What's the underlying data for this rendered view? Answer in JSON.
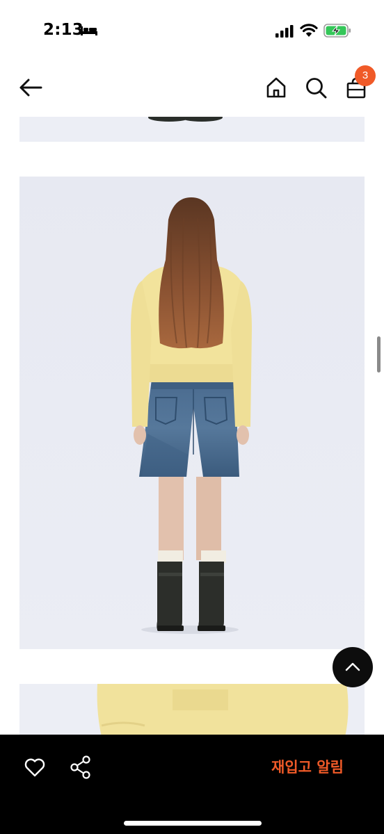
{
  "status_bar": {
    "time": "2:13",
    "icons": [
      "bed-icon",
      "signal-icon",
      "wifi-icon",
      "battery-charging-icon"
    ],
    "battery_color": "#34c759"
  },
  "nav_bar": {
    "icons": [
      "back-arrow-icon",
      "home-icon",
      "search-icon",
      "shopping-bag-icon"
    ],
    "cart_count": "3",
    "badge_color": "#f05a28"
  },
  "product_images": [
    {
      "name": "product-image-boots-partial"
    },
    {
      "name": "product-image-back-view"
    },
    {
      "name": "product-image-sweater-closeup"
    }
  ],
  "scroll_top": {
    "icon": "chevron-up-icon"
  },
  "bottom_bar": {
    "icons": [
      "heart-icon",
      "share-icon"
    ],
    "restock_label": "재입고 알림",
    "accent_color": "#f05a28"
  }
}
